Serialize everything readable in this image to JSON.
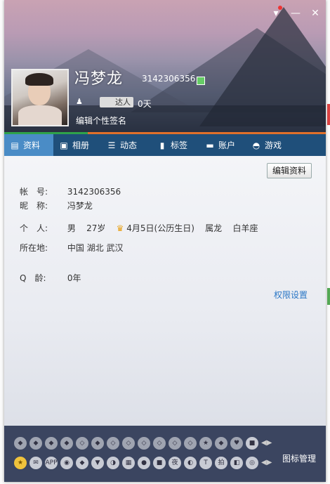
{
  "window": {
    "skin_icon": "tshirt-icon",
    "minimize_icon": "minimize-icon",
    "close_icon": "close-icon"
  },
  "profile": {
    "nickname": "冯梦龙",
    "qq_number": "3142306356",
    "vip_label": "达人",
    "days": "0天",
    "signature": "编辑个性签名"
  },
  "tabs": [
    {
      "label": "资料",
      "icon": "id-card-icon",
      "glyph": "▤"
    },
    {
      "label": "相册",
      "icon": "photo-album-icon",
      "glyph": "▣"
    },
    {
      "label": "动态",
      "icon": "feed-icon",
      "glyph": "☰"
    },
    {
      "label": "标签",
      "icon": "bookmark-icon",
      "glyph": "▮"
    },
    {
      "label": "账户",
      "icon": "briefcase-icon",
      "glyph": "▬"
    },
    {
      "label": "游戏",
      "icon": "game-icon",
      "glyph": "◓"
    }
  ],
  "details": {
    "edit_button": "编辑资料",
    "account_label": "帐　号:",
    "account_value": "3142306356",
    "nick_label": "昵　称:",
    "nick_value": "冯梦龙",
    "personal_label": "个　人:",
    "gender": "男",
    "age": "27岁",
    "birthday": "4月5日(公历生日)",
    "zodiac": "属龙",
    "constellation": "白羊座",
    "location_label": "所在地:",
    "location_value": "中国 湖北 武汉",
    "qage_label": "Q　龄:",
    "qage_value": "0年",
    "permission_link": "权限设置"
  },
  "iconbar": {
    "manage_label": "图标管理",
    "app_label": "APP",
    "night_label": "夜",
    "pai_label": "拍"
  },
  "colors": {
    "tab_bar": "#1f4f7a",
    "tab_active": "#4a8cc6",
    "link": "#2b77c6",
    "accent_orange": "#e0702a"
  }
}
